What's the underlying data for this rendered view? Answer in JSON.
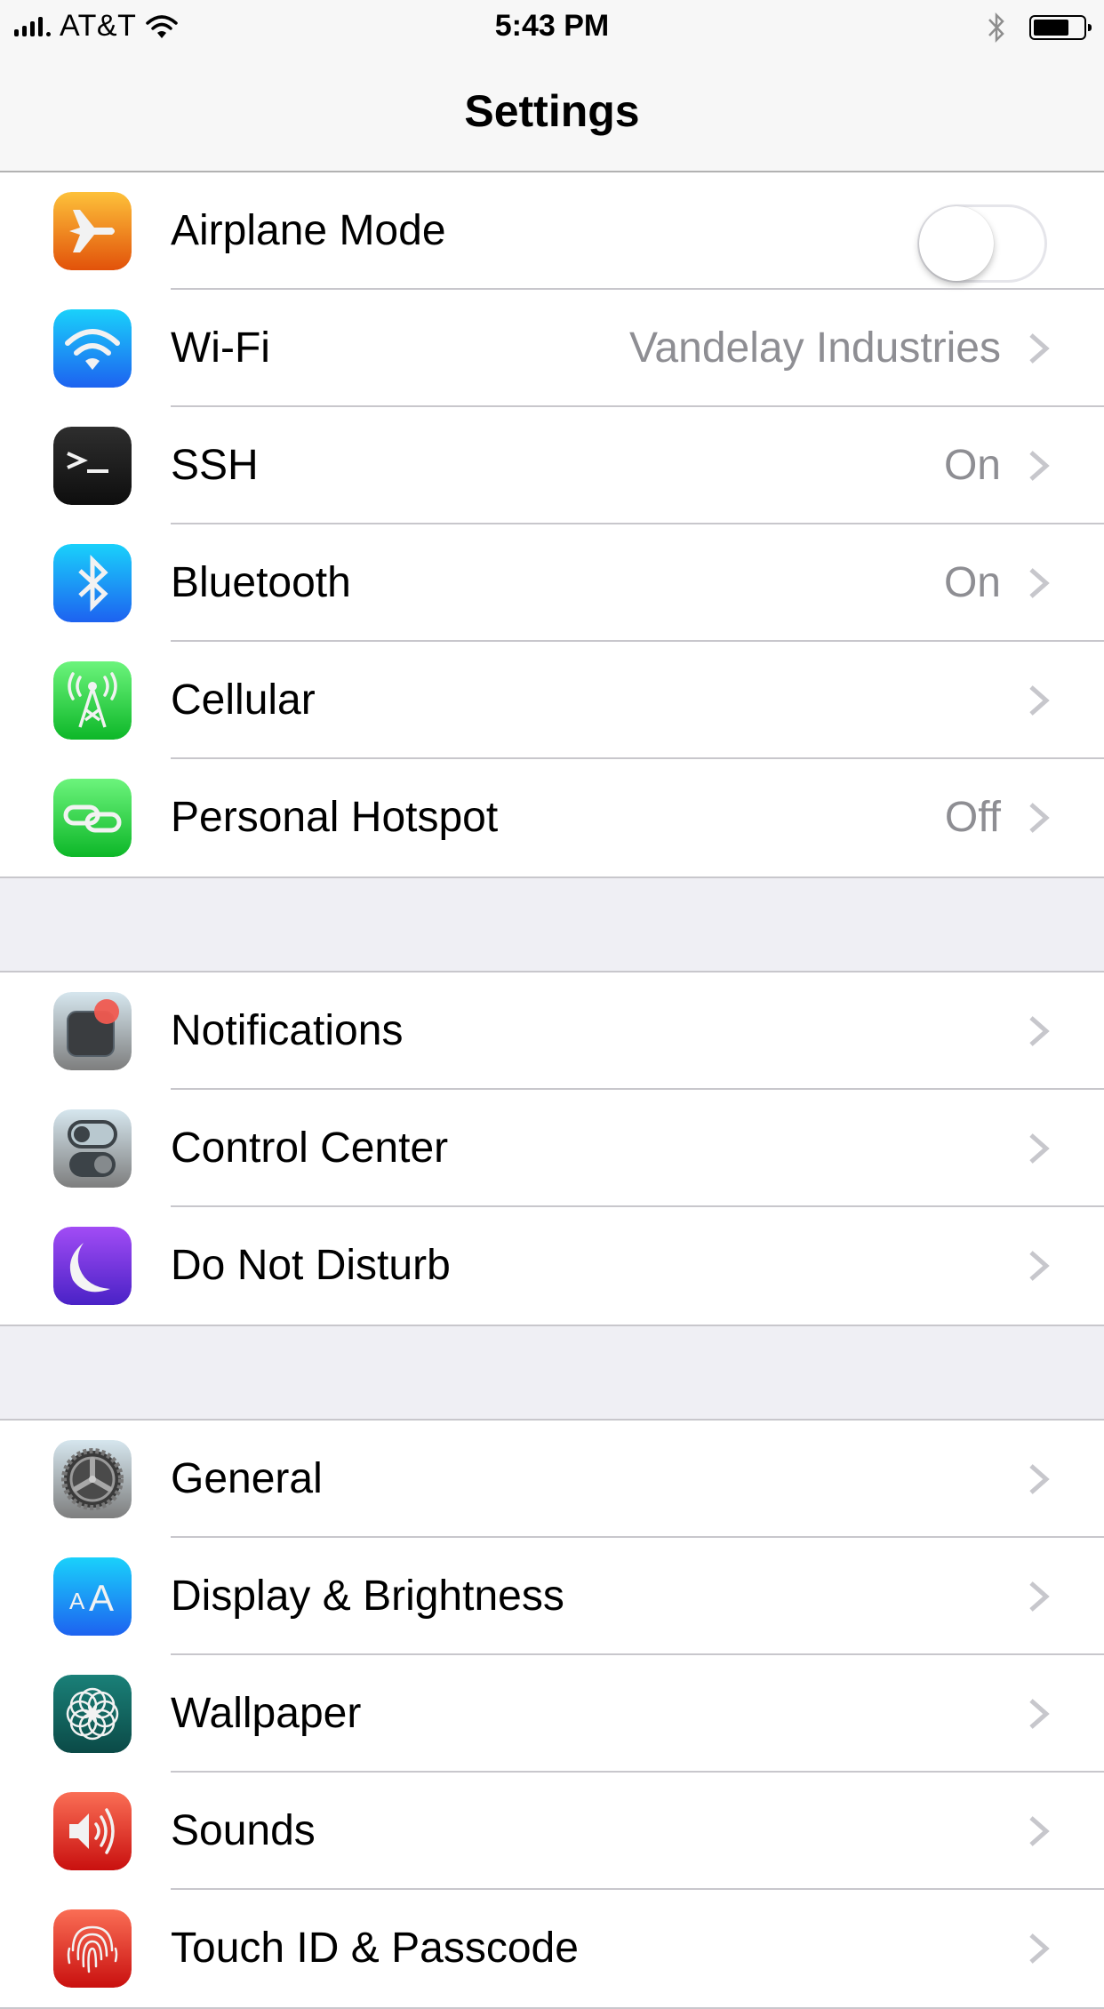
{
  "status_bar": {
    "carrier": "AT&T",
    "time": "5:43 PM",
    "battery_level_percent": 75
  },
  "nav": {
    "title": "Settings"
  },
  "groups": [
    {
      "rows": [
        {
          "label": "Airplane Mode",
          "icon": "airplane-icon",
          "control": "toggle",
          "toggle_on": false
        },
        {
          "label": "Wi-Fi",
          "icon": "wifi-icon",
          "value": "Vandelay Industries",
          "control": "chevron"
        },
        {
          "label": "SSH",
          "icon": "terminal-icon",
          "value": "On",
          "control": "chevron"
        },
        {
          "label": "Bluetooth",
          "icon": "bluetooth-icon",
          "value": "On",
          "control": "chevron"
        },
        {
          "label": "Cellular",
          "icon": "cellular-tower-icon",
          "control": "chevron"
        },
        {
          "label": "Personal Hotspot",
          "icon": "hotspot-link-icon",
          "value": "Off",
          "control": "chevron"
        }
      ]
    },
    {
      "rows": [
        {
          "label": "Notifications",
          "icon": "notifications-icon",
          "control": "chevron"
        },
        {
          "label": "Control Center",
          "icon": "control-center-icon",
          "control": "chevron"
        },
        {
          "label": "Do Not Disturb",
          "icon": "moon-icon",
          "control": "chevron"
        }
      ]
    },
    {
      "rows": [
        {
          "label": "General",
          "icon": "gear-icon",
          "control": "chevron"
        },
        {
          "label": "Display & Brightness",
          "icon": "display-aa-icon",
          "control": "chevron"
        },
        {
          "label": "Wallpaper",
          "icon": "wallpaper-flower-icon",
          "control": "chevron"
        },
        {
          "label": "Sounds",
          "icon": "speaker-icon",
          "control": "chevron"
        },
        {
          "label": "Touch ID & Passcode",
          "icon": "fingerprint-icon",
          "control": "chevron"
        }
      ]
    }
  ],
  "colors": {
    "airplane": "#f08a1c",
    "wifi": "#1a8cf5",
    "ssh": "#1c1c1c",
    "bluetooth": "#1a8cf5",
    "cellular": "#34c94a",
    "hotspot": "#34c94a",
    "notifications": "#8e8e93",
    "control_center": "#8e8e93",
    "dnd": "#6a3fd8",
    "general": "#8e8e93",
    "display": "#1a8cf5",
    "wallpaper": "#136b66",
    "sounds": "#e03a2e",
    "touchid": "#e03a2e",
    "secondary_text": "#8e8e93",
    "separator": "#c8c7cc",
    "group_bg": "#efeff4"
  }
}
